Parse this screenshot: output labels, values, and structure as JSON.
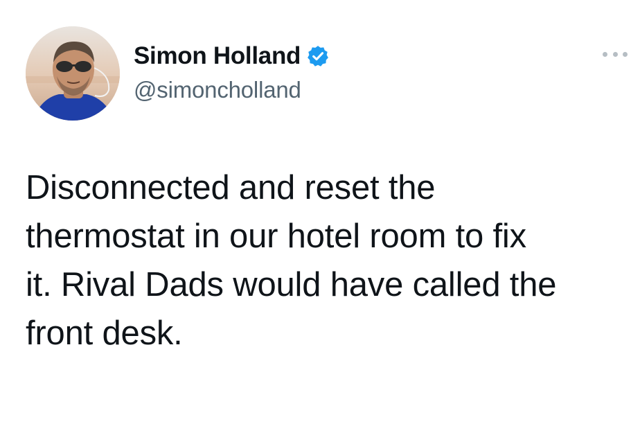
{
  "author": {
    "display_name": "Simon Holland",
    "handle": "@simoncholland",
    "verified": true,
    "verified_badge_icon": "verified-badge-icon",
    "avatar_icon": "profile-photo"
  },
  "tweet": {
    "lines": [
      "Disconnected and reset the",
      "thermostat in our hotel room to fix",
      "it. Rival Dads would have called the",
      "front desk."
    ]
  },
  "menu": {
    "icon": "more-options-icon"
  },
  "colors": {
    "background": "#ffffff",
    "text": "#0f1419",
    "secondary_text": "#536471",
    "verified_blue": "#1d9bf0"
  }
}
